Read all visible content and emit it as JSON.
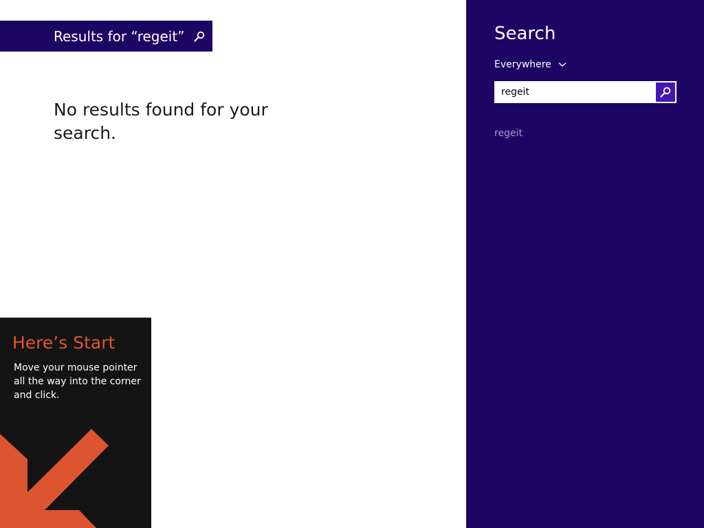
{
  "results": {
    "title": "Results for “regeit”",
    "message": "No results found for your search."
  },
  "start_tip": {
    "title": "Here’s Start",
    "body": "Move your mouse pointer all the way into the corner and click."
  },
  "search_pane": {
    "title": "Search",
    "scope": "Everywhere",
    "query": "regeit",
    "suggestions": [
      "regeit"
    ]
  },
  "icons": {
    "results_search": "search-icon",
    "scope_chevron": "chevron-down-icon",
    "go": "search-icon",
    "start_arrow": "arrow-down-left-icon"
  },
  "colors": {
    "accent": "#1d0663",
    "search_button": "#4617b4",
    "tip_background": "#141414",
    "tip_title": "#e0552f",
    "arrow": "#dc5530",
    "suggestion": "#a99bd6"
  }
}
